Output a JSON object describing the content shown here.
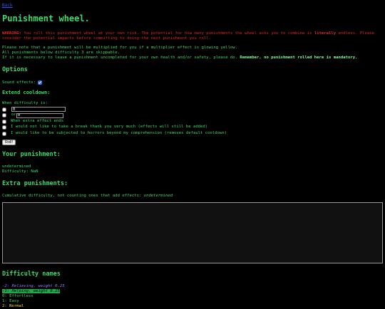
{
  "nav": {
    "back_label": "Back"
  },
  "page": {
    "title": "Punishment wheel."
  },
  "warning": {
    "prefix": "WARNING:",
    "text_1": " You roll this punishment wheel at your own risk. The potential for how many punishments the wheel asks you to combine is ",
    "emphasis": "literally",
    "text_2": " endless. Please consider the potential impacts before committing to doing the next punishment you roll."
  },
  "notes": {
    "line_1": "Please note that a punishment will be multiplied for you if a multiplier effect is glowing yellow.",
    "line_2": "All punishments below difficulty 3 are skippable.",
    "line_3": "If it is necessary to leave a punishment uncompleted for your own health and/or safety, please do. ",
    "line_3_bold": "Remember, no punishment rolled here is mandatory."
  },
  "options": {
    "heading": "Options",
    "sound_effects_label": "Sound effects:",
    "sound_effects_checked": true
  },
  "cooldown": {
    "heading": "Extend cooldown:",
    "when_label": "When difficulty is:",
    "input_1_value": "0",
    "or_label": "or ",
    "input_2_value": "0",
    "extra_effects_label": "When extra effect ends",
    "no_break_label": "I would not like to take a break thank you very much (effects will still be added)",
    "horrors_label": "I would like to be subjected to horrors beyond my comprehension (removes default cooldown)",
    "roll_label": "Roll!"
  },
  "your_punishment": {
    "heading": "Your punishment:",
    "value": "undetermined",
    "difficulty_label": "Difficulty: ",
    "difficulty_value": "NaN"
  },
  "extra": {
    "heading": "Extra punishments:",
    "cumulative_label": "Cumulative difficulty, not counting ones that add effects: ",
    "cumulative_value": "undetermined"
  },
  "difficulty_names": {
    "heading": "Difficulty names",
    "items": [
      "-2: Relieving, weight 0.25",
      "-1: Helping, weight 0.25",
      "0: Effortless",
      "1: Easy",
      "2: Normal"
    ]
  },
  "colors": {
    "text": "#3fd96a",
    "warning": "#e02525",
    "link": "#3355ff",
    "relieving": "#9d7bff",
    "helping_bg": "#22a84a",
    "normal": "#ffd83a"
  }
}
